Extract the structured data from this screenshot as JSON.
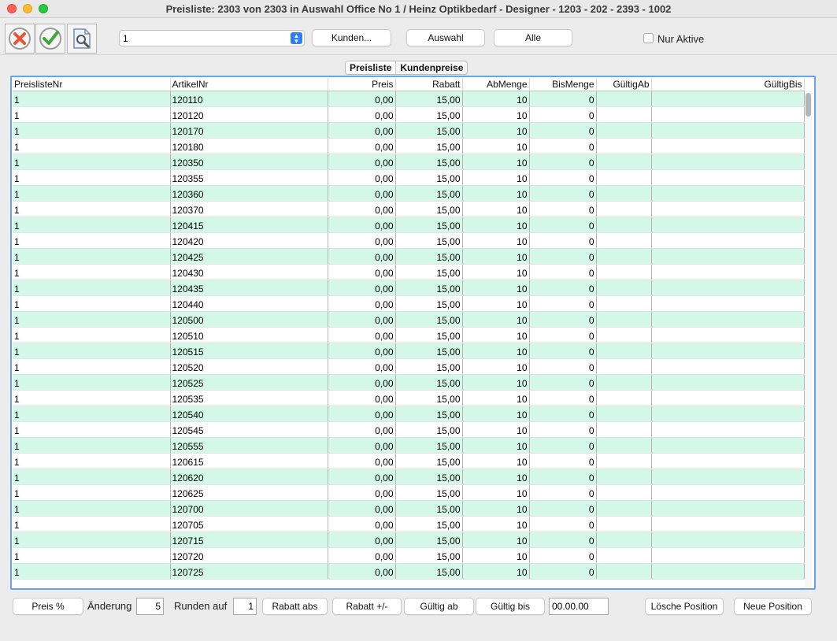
{
  "window": {
    "title": "Preisliste: 2303 von 2303 in Auswahl Office No 1 /  Heinz Optikbedarf - Designer - 1203 - 202 - 2393 - 1002"
  },
  "toolbar": {
    "select_value": "1",
    "kunden_label": "Kunden...",
    "auswahl_label": "Auswahl",
    "alle_label": "Alle",
    "nur_aktive_label": "Nur Aktive"
  },
  "tabs": [
    {
      "label": "Preisliste"
    },
    {
      "label": "Kundenpreise"
    }
  ],
  "table": {
    "columns": [
      "PreislisteNr",
      "ArtikelNr",
      "Preis",
      "Rabatt",
      "AbMenge",
      "BisMenge",
      "GültigAb",
      "GültigBis"
    ],
    "rows": [
      [
        "1",
        "120110",
        "0,00",
        "15,00",
        "10",
        "0",
        "",
        ""
      ],
      [
        "1",
        "120120",
        "0,00",
        "15,00",
        "10",
        "0",
        "",
        ""
      ],
      [
        "1",
        "120170",
        "0,00",
        "15,00",
        "10",
        "0",
        "",
        ""
      ],
      [
        "1",
        "120180",
        "0,00",
        "15,00",
        "10",
        "0",
        "",
        ""
      ],
      [
        "1",
        "120350",
        "0,00",
        "15,00",
        "10",
        "0",
        "",
        ""
      ],
      [
        "1",
        "120355",
        "0,00",
        "15,00",
        "10",
        "0",
        "",
        ""
      ],
      [
        "1",
        "120360",
        "0,00",
        "15,00",
        "10",
        "0",
        "",
        ""
      ],
      [
        "1",
        "120370",
        "0,00",
        "15,00",
        "10",
        "0",
        "",
        ""
      ],
      [
        "1",
        "120415",
        "0,00",
        "15,00",
        "10",
        "0",
        "",
        ""
      ],
      [
        "1",
        "120420",
        "0,00",
        "15,00",
        "10",
        "0",
        "",
        ""
      ],
      [
        "1",
        "120425",
        "0,00",
        "15,00",
        "10",
        "0",
        "",
        ""
      ],
      [
        "1",
        "120430",
        "0,00",
        "15,00",
        "10",
        "0",
        "",
        ""
      ],
      [
        "1",
        "120435",
        "0,00",
        "15,00",
        "10",
        "0",
        "",
        ""
      ],
      [
        "1",
        "120440",
        "0,00",
        "15,00",
        "10",
        "0",
        "",
        ""
      ],
      [
        "1",
        "120500",
        "0,00",
        "15,00",
        "10",
        "0",
        "",
        ""
      ],
      [
        "1",
        "120510",
        "0,00",
        "15,00",
        "10",
        "0",
        "",
        ""
      ],
      [
        "1",
        "120515",
        "0,00",
        "15,00",
        "10",
        "0",
        "",
        ""
      ],
      [
        "1",
        "120520",
        "0,00",
        "15,00",
        "10",
        "0",
        "",
        ""
      ],
      [
        "1",
        "120525",
        "0,00",
        "15,00",
        "10",
        "0",
        "",
        ""
      ],
      [
        "1",
        "120535",
        "0,00",
        "15,00",
        "10",
        "0",
        "",
        ""
      ],
      [
        "1",
        "120540",
        "0,00",
        "15,00",
        "10",
        "0",
        "",
        ""
      ],
      [
        "1",
        "120545",
        "0,00",
        "15,00",
        "10",
        "0",
        "",
        ""
      ],
      [
        "1",
        "120555",
        "0,00",
        "15,00",
        "10",
        "0",
        "",
        ""
      ],
      [
        "1",
        "120615",
        "0,00",
        "15,00",
        "10",
        "0",
        "",
        ""
      ],
      [
        "1",
        "120620",
        "0,00",
        "15,00",
        "10",
        "0",
        "",
        ""
      ],
      [
        "1",
        "120625",
        "0,00",
        "15,00",
        "10",
        "0",
        "",
        ""
      ],
      [
        "1",
        "120700",
        "0,00",
        "15,00",
        "10",
        "0",
        "",
        ""
      ],
      [
        "1",
        "120705",
        "0,00",
        "15,00",
        "10",
        "0",
        "",
        ""
      ],
      [
        "1",
        "120715",
        "0,00",
        "15,00",
        "10",
        "0",
        "",
        ""
      ],
      [
        "1",
        "120720",
        "0,00",
        "15,00",
        "10",
        "0",
        "",
        ""
      ],
      [
        "1",
        "120725",
        "0,00",
        "15,00",
        "10",
        "0",
        "",
        ""
      ]
    ]
  },
  "bottom": {
    "preis_pct_label": "Preis %",
    "aenderung_label": "Änderung",
    "aenderung_value": "5",
    "runden_label": "Runden auf",
    "runden_value": "1",
    "rabatt_abs_label": "Rabatt abs",
    "rabatt_pm_label": "Rabatt +/-",
    "gueltig_ab_label": "Gültig ab",
    "gueltig_bis_label": "Gültig bis",
    "date_value": "00.00.00",
    "loesche_label": "Lösche Position",
    "neue_label": "Neue Position"
  },
  "icons": {
    "cancel": "cancel-x-icon",
    "confirm": "checkmark-icon",
    "search": "document-search-icon"
  },
  "colors": {
    "row_alt": "#d4f8e8",
    "focus_border": "#6aa2f0",
    "select_accent": "#2e7cf6"
  }
}
